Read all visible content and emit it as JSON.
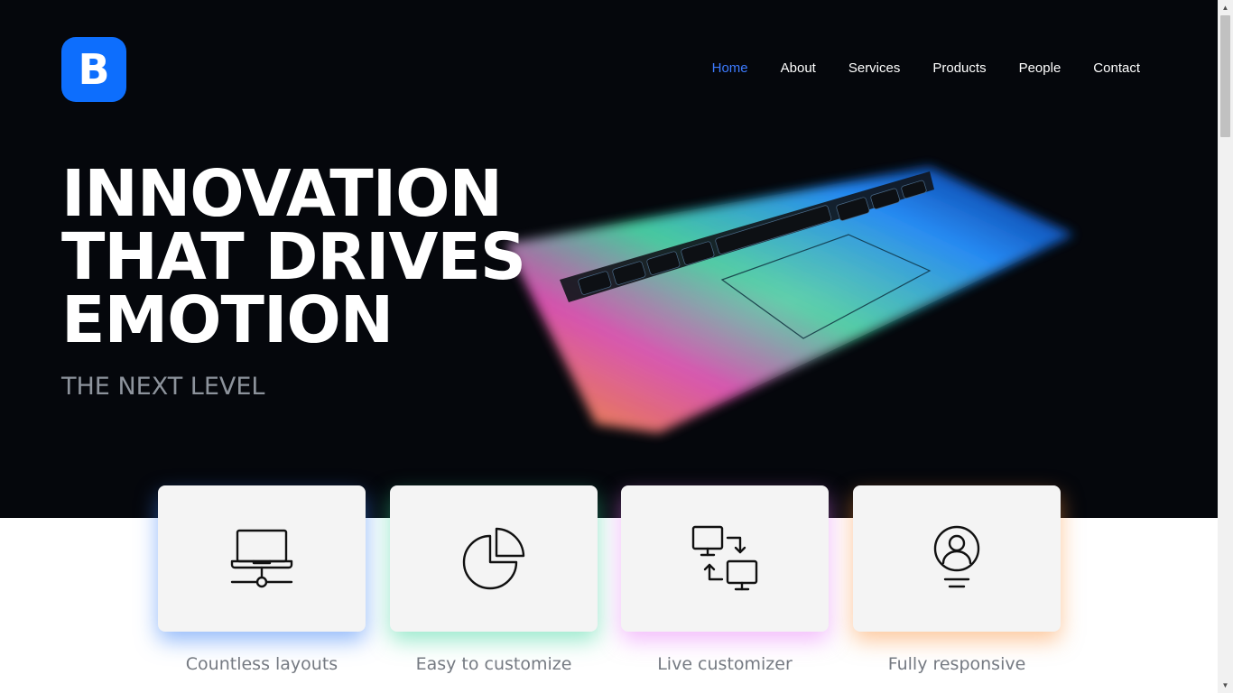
{
  "brand": {
    "logo_letter": "B",
    "color": "#0d6efd"
  },
  "nav": {
    "items": [
      {
        "label": "Home",
        "active": true
      },
      {
        "label": "About"
      },
      {
        "label": "Services"
      },
      {
        "label": "Products"
      },
      {
        "label": "People"
      },
      {
        "label": "Contact"
      }
    ],
    "active_color": "#3d7bff"
  },
  "hero": {
    "headline_lines": [
      "INNOVATION",
      "THAT DRIVES",
      "EMOTION"
    ],
    "subheading": "THE NEXT LEVEL",
    "background": "#05070c",
    "image": "laptop-keyboard-rainbow-glow"
  },
  "features": [
    {
      "label": "Countless layouts",
      "icon": "laptop-network-icon",
      "glow": "#3b82f6"
    },
    {
      "label": "Easy to customize",
      "icon": "pie-chart-icon",
      "glow": "#34d399"
    },
    {
      "label": "Live customizer",
      "icon": "monitor-sync-icon",
      "glow": "#e879f9"
    },
    {
      "label": "Fully responsive",
      "icon": "user-profile-icon",
      "glow": "#fb923c"
    }
  ]
}
